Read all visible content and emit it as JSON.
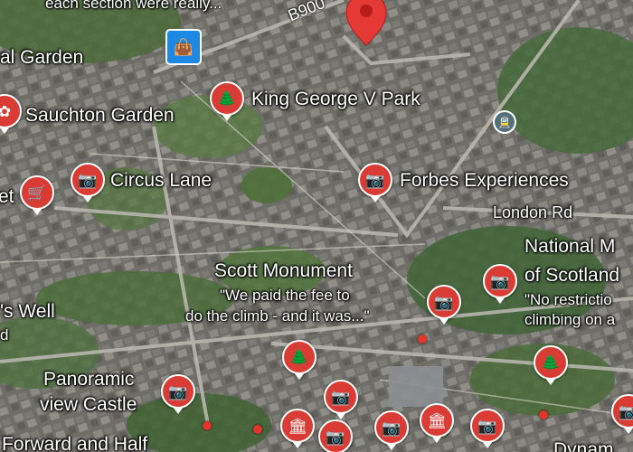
{
  "map": {
    "top_snippet": "each section were really...",
    "road_labels": {
      "b900": "B900",
      "london_rd": "London Rd"
    },
    "places": {
      "royal_garden": "al Garden",
      "sauchton_garden": "Sauchton Garden",
      "king_george_park": "King George V Park",
      "circus_lane": "Circus Lane",
      "market_partial": "et",
      "forbes": "Forbes Experiences",
      "national_museum_line1": "National M",
      "national_museum_line2": "of Scotland",
      "national_museum_review1": "\"No restrictio",
      "national_museum_review2": "climbing on a",
      "scott_monument": "Scott Monument",
      "scott_review1": "\"We paid the fee to",
      "scott_review2": "do the climb - and it  was...\"",
      "wells_well_line1": "'s Well",
      "wells_well_line2": "d",
      "panoramic_line1": "Panoramic",
      "panoramic_line2": "view Castle",
      "forward_half": "Forward and Half",
      "bottom_partial": "Dynam"
    },
    "icons": {
      "camera": "📷",
      "tree": "🌲",
      "cart": "🛒",
      "museum": "🏛",
      "flower": "✿",
      "bag": "👜",
      "tram": "🚊"
    },
    "colors": {
      "pin": "#d93c34",
      "selected_pin": "#e53935",
      "store_icon": "#1e88e5"
    }
  }
}
